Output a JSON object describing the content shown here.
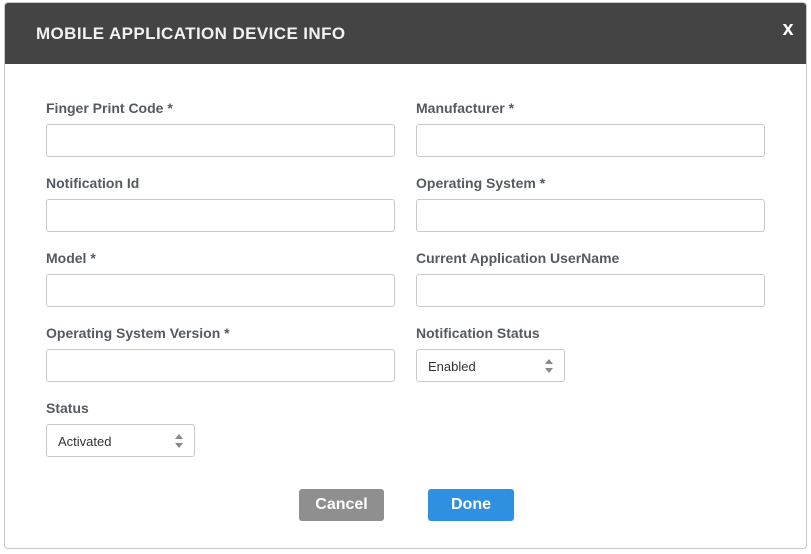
{
  "modal": {
    "title": "MOBILE APPLICATION DEVICE INFO",
    "close_label": "x"
  },
  "fields": {
    "fingerprint": {
      "label": "Finger Print Code *",
      "value": ""
    },
    "manufacturer": {
      "label": "Manufacturer *",
      "value": ""
    },
    "notification_id": {
      "label": "Notification Id",
      "value": ""
    },
    "operating_system": {
      "label": "Operating System *",
      "value": ""
    },
    "model": {
      "label": "Model *",
      "value": ""
    },
    "current_user": {
      "label": "Current Application UserName",
      "value": ""
    },
    "os_version": {
      "label": "Operating System Version *",
      "value": ""
    },
    "notification_status": {
      "label": "Notification Status",
      "value": "Enabled"
    },
    "status": {
      "label": "Status",
      "value": "Activated"
    }
  },
  "buttons": {
    "cancel_label": "Cancel",
    "done_label": "Done"
  },
  "colors": {
    "header_bg": "#444444",
    "label_text": "#555a60",
    "cancel_bg": "#8f8f8f",
    "done_bg": "#2f8fe0"
  },
  "icons": {
    "close": "close-icon",
    "select_arrows": "select-arrows-icon"
  }
}
